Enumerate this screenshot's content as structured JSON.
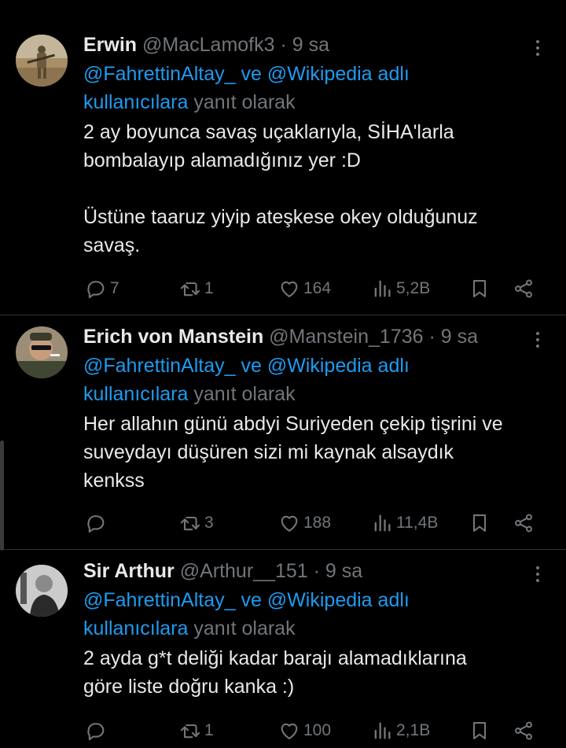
{
  "tweets": [
    {
      "name": "Erwin",
      "handle": "@MacLamofk3",
      "dot": "·",
      "time": "9 sa",
      "mention1": "@FahrettinAltay_",
      "ve": " ve ",
      "mention2": "@Wikipedia",
      "adli": " adlı",
      "kullanicilara": "kullanıcılara",
      "yanit": " yanıt olarak",
      "text": "2 ay boyunca savaş uçaklarıyla, SİHA'larla\nbombalayıp alamadığınız yer :D\n\nÜstüne taaruz yiyip ateşkese okey olduğunuz\nsavaş.",
      "replies": "7",
      "retweets": "1",
      "likes": "164",
      "views": "5,2B"
    },
    {
      "name": "Erich von Manstein",
      "handle": "@Manstein_1736",
      "dot": "·",
      "time": "9 sa",
      "mention1": "@FahrettinAltay_",
      "ve": " ve ",
      "mention2": "@Wikipedia",
      "adli": " adlı",
      "kullanicilara": "kullanıcılara",
      "yanit": " yanıt olarak",
      "text": "Her allahın günü abdyi Suriyeden çekip tişrini ve\nsuveydayı düşüren sizi mi kaynak alsaydık\nkenkss",
      "replies": "",
      "retweets": "3",
      "likes": "188",
      "views": "11,4B"
    },
    {
      "name": "Sir Arthur",
      "handle": "@Arthur__151",
      "dot": "·",
      "time": "9 sa",
      "mention1": "@FahrettinAltay_",
      "ve": " ve ",
      "mention2": "@Wikipedia",
      "adli": " adlı",
      "kullanicilara": "kullanıcılara",
      "yanit": " yanıt olarak",
      "text": "2 ayda g*t deliği kadar barajı alamadıklarına\ngöre liste doğru kanka :)",
      "replies": "",
      "retweets": "1",
      "likes": "100",
      "views": "2,1B"
    }
  ],
  "icons": {
    "reply": "reply-icon",
    "retweet": "retweet-icon",
    "like": "heart-icon",
    "views": "views-icon",
    "bookmark": "bookmark-icon",
    "share": "share-icon",
    "more": "more-icon"
  },
  "colors": {
    "background": "#000000",
    "text": "#e7e9ea",
    "muted": "#71767b",
    "link": "#1d9bf0",
    "divider": "#2f3336"
  }
}
